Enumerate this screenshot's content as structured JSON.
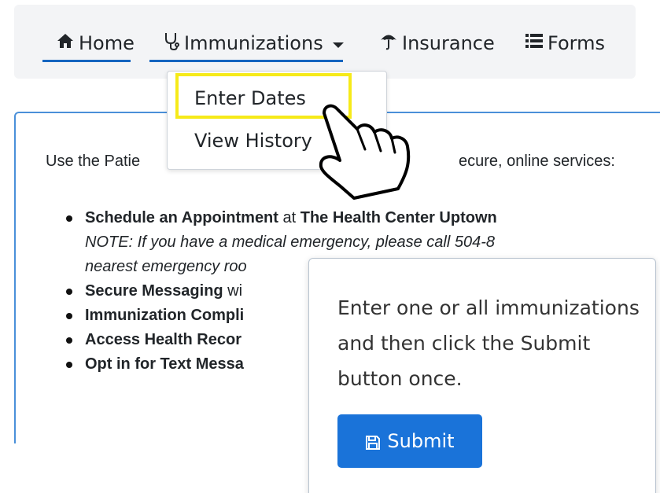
{
  "navbar": {
    "items": [
      {
        "label": "Home",
        "icon": "home-icon"
      },
      {
        "label": "Immunizations",
        "icon": "stethoscope-icon"
      },
      {
        "label": "Insurance",
        "icon": "umbrella-icon"
      },
      {
        "label": "Forms",
        "icon": "list-icon"
      }
    ]
  },
  "dropdown": {
    "items": [
      {
        "label": "Enter Dates"
      },
      {
        "label": "View History"
      }
    ]
  },
  "main": {
    "intro_left": "Use the Patie",
    "intro_right": "ecure, online services:",
    "bullets": [
      {
        "bold": "Schedule an Appointment",
        "rest": " at ",
        "bold2": "The Health Center Uptown"
      },
      {
        "note": "NOTE: If you have a medical emergency, please call 504-8"
      },
      {
        "note": "nearest emergency roo"
      },
      {
        "bold": "Secure Messaging",
        "rest": " wi"
      },
      {
        "bold": "Immunization Compli"
      },
      {
        "bold": "Access Health Recor"
      },
      {
        "bold": "Opt in for Text Messa"
      }
    ]
  },
  "popover": {
    "text": "Enter one or all immunizations and then click the Submit button once.",
    "button_label": "Submit",
    "button_icon": "save-icon"
  },
  "colors": {
    "accent_blue": "#1565c0",
    "button_blue": "#1a73d9",
    "highlight_yellow": "#f6ea19",
    "navbar_bg": "#f3f4f6"
  }
}
